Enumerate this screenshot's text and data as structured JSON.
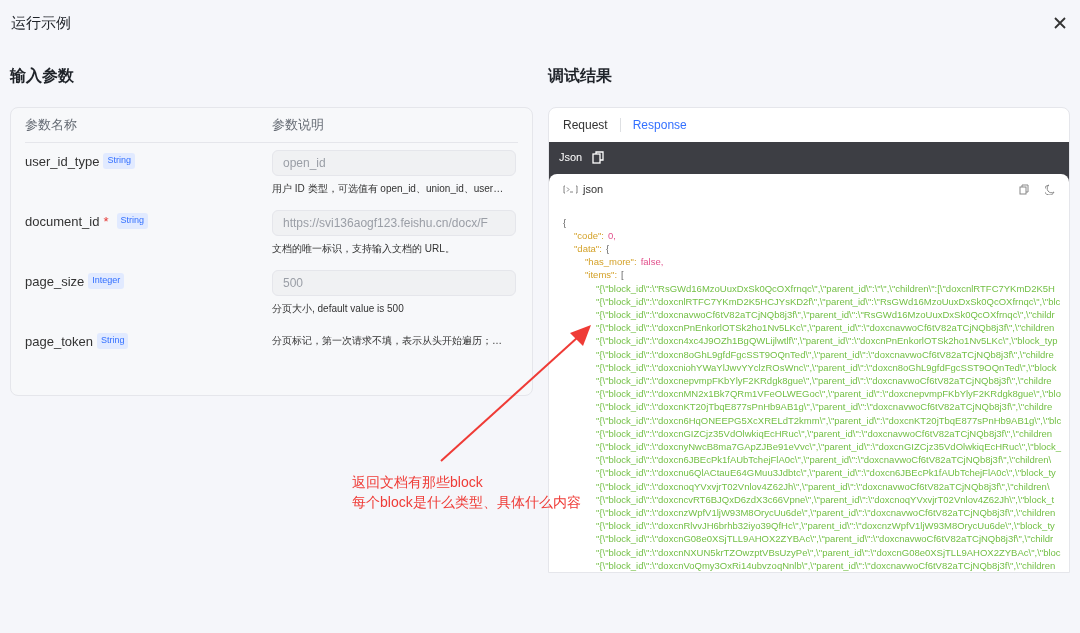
{
  "dialog": {
    "title": "运行示例"
  },
  "input_params": {
    "title": "输入参数",
    "columns": [
      "参数名称",
      "参数说明"
    ],
    "params": [
      {
        "name": "user_id_type",
        "type": "String",
        "value": "open_id",
        "disabled": true,
        "description": "用户 ID 类型，可选值有 open_id、union_id、user…"
      },
      {
        "name": "document_id",
        "required_mark": "*",
        "type": "String",
        "value": "https://svi136aogf123.feishu.cn/docx/F",
        "disabled": true,
        "description": "文档的唯一标识，支持输入文档的 URL。"
      },
      {
        "name": "page_size",
        "type": "Integer",
        "value": "500",
        "disabled": true,
        "description": "分页大小, default value is 500"
      },
      {
        "name": "page_token",
        "type": "String",
        "description": "分页标记，第一次请求不填，表示从头开始遍历；…"
      }
    ]
  },
  "debug_result": {
    "title": "调试结果",
    "tabs": [
      {
        "label": "Request",
        "selected": false
      },
      {
        "label": "Response",
        "selected": true
      }
    ],
    "format_label": "Json",
    "code_block": {
      "language": "json",
      "code": {
        "value": "{",
        "kind": "punct",
        "children": [
          {
            "key": "\"code\":",
            "value": "0,",
            "kind": "number"
          },
          {
            "key": "\"data\":",
            "value": "{",
            "kind": "punct",
            "children": [
              {
                "key": "\"has_more\":",
                "value": "false,",
                "kind": "boolean"
              },
              {
                "key": "\"items\":",
                "value": "[",
                "kind": "punct",
                "children": [
                  {
                    "value": "\"{\\\"block_id\\\":\\\"RsGWd16MzoUuxDxSk0QcOXfrnqc\\\",\\\"parent_id\\\":\\\"\\\",\\\"children\\\":[\\\"doxcnlRTFC7YKmD2K5H",
                    "kind": "string"
                  },
                  {
                    "value": "\"{\\\"block_id\\\":\\\"doxcnlRTFC7YKmD2K5HCJYsKD2f\\\",\\\"parent_id\\\":\\\"RsGWd16MzoUuxDxSk0QcOXfrnqc\\\",\\\"blc",
                    "kind": "string"
                  },
                  {
                    "value": "\"{\\\"block_id\\\":\\\"doxcnavwoCf6tV82aTCjNQb8j3f\\\",\\\"parent_id\\\":\\\"RsGWd16MzoUuxDxSk0QcOXfrnqc\\\",\\\"childr",
                    "kind": "string"
                  },
                  {
                    "value": "\"{\\\"block_id\\\":\\\"doxcnPnEnkorlOTSk2ho1Nv5LKc\\\",\\\"parent_id\\\":\\\"doxcnavwoCf6tV82aTCjNQb8j3f\\\",\\\"children",
                    "kind": "string"
                  },
                  {
                    "value": "\"{\\\"block_id\\\":\\\"doxcn4xc4J9OZh1BgQWLijlwtlf\\\",\\\"parent_id\\\":\\\"doxcnPnEnkorlOTSk2ho1Nv5LKc\\\",\\\"block_typ",
                    "kind": "string"
                  },
                  {
                    "value": "\"{\\\"block_id\\\":\\\"doxcn8oGhL9gfdFgcSST9OQnTed\\\",\\\"parent_id\\\":\\\"doxcnavwoCf6tV82aTCjNQb8j3f\\\",\\\"childre",
                    "kind": "string"
                  },
                  {
                    "value": "\"{\\\"block_id\\\":\\\"doxcniohYWaYlJwvYYclzROsWnc\\\",\\\"parent_id\\\":\\\"doxcn8oGhL9gfdFgcSST9OQnTed\\\",\\\"block",
                    "kind": "string"
                  },
                  {
                    "value": "\"{\\\"block_id\\\":\\\"doxcnepvmpFKbYlyF2KRdgk8gue\\\",\\\"parent_id\\\":\\\"doxcnavwoCf6tV82aTCjNQb8j3f\\\",\\\"childre",
                    "kind": "string"
                  },
                  {
                    "value": "\"{\\\"block_id\\\":\\\"doxcnMN2x1Bk7QRm1VFeOLWEGoc\\\",\\\"parent_id\\\":\\\"doxcnepvmpFKbYlyF2KRdgk8gue\\\",\\\"blo",
                    "kind": "string"
                  },
                  {
                    "value": "\"{\\\"block_id\\\":\\\"doxcnKT20jTbqE877sPnHb9AB1g\\\",\\\"parent_id\\\":\\\"doxcnavwoCf6tV82aTCjNQb8j3f\\\",\\\"childre",
                    "kind": "string"
                  },
                  {
                    "value": "\"{\\\"block_id\\\":\\\"doxcn6HqONEEPG5XcXRELdT2kmm\\\",\\\"parent_id\\\":\\\"doxcnKT20jTbqE877sPnHb9AB1g\\\",\\\"blc",
                    "kind": "string"
                  },
                  {
                    "value": "\"{\\\"block_id\\\":\\\"doxcnGIZCjz35VdOlwkiqEcHRuc\\\",\\\"parent_id\\\":\\\"doxcnavwoCf6tV82aTCjNQb8j3f\\\",\\\"children",
                    "kind": "string"
                  },
                  {
                    "value": "\"{\\\"block_id\\\":\\\"doxcnyNwcB8ma7GApZJBe91eVvc\\\",\\\"parent_id\\\":\\\"doxcnGIZCjz35VdOlwkiqEcHRuc\\\",\\\"block_",
                    "kind": "string"
                  },
                  {
                    "value": "\"{\\\"block_id\\\":\\\"doxcn6JBEcPk1fAUbTchejFlA0c\\\",\\\"parent_id\\\":\\\"doxcnavwoCf6tV82aTCjNQb8j3f\\\",\\\"children\\",
                    "kind": "string"
                  },
                  {
                    "value": "\"{\\\"block_id\\\":\\\"doxcnu6QlACtauE64GMuu3Jdbtc\\\",\\\"parent_id\\\":\\\"doxcn6JBEcPk1fAUbTchejFlA0c\\\",\\\"block_ty",
                    "kind": "string"
                  },
                  {
                    "value": "\"{\\\"block_id\\\":\\\"doxcnoqYVxvjrT02Vnlov4Z62Jh\\\",\\\"parent_id\\\":\\\"doxcnavwoCf6tV82aTCjNQb8j3f\\\",\\\"children\\",
                    "kind": "string"
                  },
                  {
                    "value": "\"{\\\"block_id\\\":\\\"doxcncvRT6BJQxD6zdX3c66Vpne\\\",\\\"parent_id\\\":\\\"doxcnoqYVxvjrT02Vnlov4Z62Jh\\\",\\\"block_t",
                    "kind": "string"
                  },
                  {
                    "value": "\"{\\\"block_id\\\":\\\"doxcnzWpfV1ljW93M8OrycUu6de\\\",\\\"parent_id\\\":\\\"doxcnavwoCf6tV82aTCjNQb8j3f\\\",\\\"children",
                    "kind": "string"
                  },
                  {
                    "value": "\"{\\\"block_id\\\":\\\"doxcnRlvvJH6brhb32iyo39QfHc\\\",\\\"parent_id\\\":\\\"doxcnzWpfV1ljW93M8OrycUu6de\\\",\\\"block_ty",
                    "kind": "string"
                  },
                  {
                    "value": "\"{\\\"block_id\\\":\\\"doxcnG08e0XSjTLL9AHOX2ZYBAc\\\",\\\"parent_id\\\":\\\"doxcnavwoCf6tV82aTCjNQb8j3f\\\",\\\"childr",
                    "kind": "string"
                  },
                  {
                    "value": "\"{\\\"block_id\\\":\\\"doxcnNXUN5krTZOwzptVBsUzyPe\\\",\\\"parent_id\\\":\\\"doxcnG08e0XSjTLL9AHOX2ZYBAc\\\",\\\"bloc",
                    "kind": "string"
                  },
                  {
                    "value": "\"{\\\"block_id\\\":\\\"doxcnVoQmy3OxRi14ubvzoqNnlb\\\",\\\"parent_id\\\":\\\"doxcnavwoCf6tV82aTCjNQb8j3f\\\",\\\"children",
                    "kind": "string"
                  }
                ]
              }
            ]
          }
        ]
      }
    }
  },
  "annotation": {
    "lines": [
      "返回文档有那些block",
      "每个block是什么类型、具体什么内容"
    ]
  }
}
